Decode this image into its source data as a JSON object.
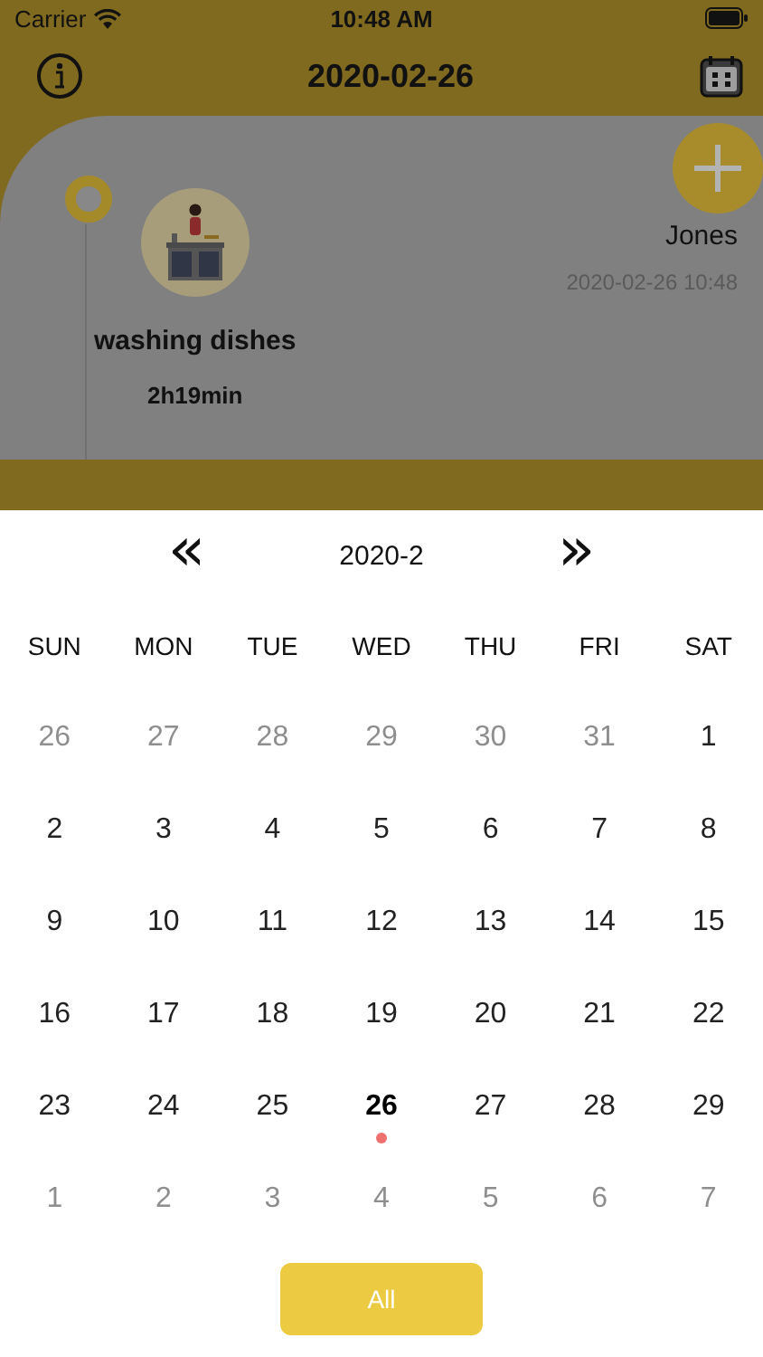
{
  "status_bar": {
    "carrier": "Carrier",
    "time": "10:48 AM"
  },
  "header": {
    "title": "2020-02-26"
  },
  "timeline": {
    "entries": [
      {
        "activity": "washing dishes",
        "duration": "2h19min",
        "person": "Jones",
        "timestamp": "2020-02-26 10:48"
      }
    ]
  },
  "calendar": {
    "prev": "«",
    "month": "2020-2",
    "next": "»",
    "weekdays": [
      "SUN",
      "MON",
      "TUE",
      "WED",
      "THU",
      "FRI",
      "SAT"
    ],
    "days": [
      {
        "label": "26",
        "in_month": false,
        "selected": false
      },
      {
        "label": "27",
        "in_month": false,
        "selected": false
      },
      {
        "label": "28",
        "in_month": false,
        "selected": false
      },
      {
        "label": "29",
        "in_month": false,
        "selected": false
      },
      {
        "label": "30",
        "in_month": false,
        "selected": false
      },
      {
        "label": "31",
        "in_month": false,
        "selected": false
      },
      {
        "label": "1",
        "in_month": true,
        "selected": false
      },
      {
        "label": "2",
        "in_month": true,
        "selected": false
      },
      {
        "label": "3",
        "in_month": true,
        "selected": false
      },
      {
        "label": "4",
        "in_month": true,
        "selected": false
      },
      {
        "label": "5",
        "in_month": true,
        "selected": false
      },
      {
        "label": "6",
        "in_month": true,
        "selected": false
      },
      {
        "label": "7",
        "in_month": true,
        "selected": false
      },
      {
        "label": "8",
        "in_month": true,
        "selected": false
      },
      {
        "label": "9",
        "in_month": true,
        "selected": false
      },
      {
        "label": "10",
        "in_month": true,
        "selected": false
      },
      {
        "label": "11",
        "in_month": true,
        "selected": false
      },
      {
        "label": "12",
        "in_month": true,
        "selected": false
      },
      {
        "label": "13",
        "in_month": true,
        "selected": false
      },
      {
        "label": "14",
        "in_month": true,
        "selected": false
      },
      {
        "label": "15",
        "in_month": true,
        "selected": false
      },
      {
        "label": "16",
        "in_month": true,
        "selected": false
      },
      {
        "label": "17",
        "in_month": true,
        "selected": false
      },
      {
        "label": "18",
        "in_month": true,
        "selected": false
      },
      {
        "label": "19",
        "in_month": true,
        "selected": false
      },
      {
        "label": "20",
        "in_month": true,
        "selected": false
      },
      {
        "label": "21",
        "in_month": true,
        "selected": false
      },
      {
        "label": "22",
        "in_month": true,
        "selected": false
      },
      {
        "label": "23",
        "in_month": true,
        "selected": false
      },
      {
        "label": "24",
        "in_month": true,
        "selected": false
      },
      {
        "label": "25",
        "in_month": true,
        "selected": false
      },
      {
        "label": "26",
        "in_month": true,
        "selected": true
      },
      {
        "label": "27",
        "in_month": true,
        "selected": false
      },
      {
        "label": "28",
        "in_month": true,
        "selected": false
      },
      {
        "label": "29",
        "in_month": true,
        "selected": false
      },
      {
        "label": "1",
        "in_month": false,
        "selected": false
      },
      {
        "label": "2",
        "in_month": false,
        "selected": false
      },
      {
        "label": "3",
        "in_month": false,
        "selected": false
      },
      {
        "label": "4",
        "in_month": false,
        "selected": false
      },
      {
        "label": "5",
        "in_month": false,
        "selected": false
      },
      {
        "label": "6",
        "in_month": false,
        "selected": false
      },
      {
        "label": "7",
        "in_month": false,
        "selected": false
      }
    ],
    "button": "All"
  }
}
